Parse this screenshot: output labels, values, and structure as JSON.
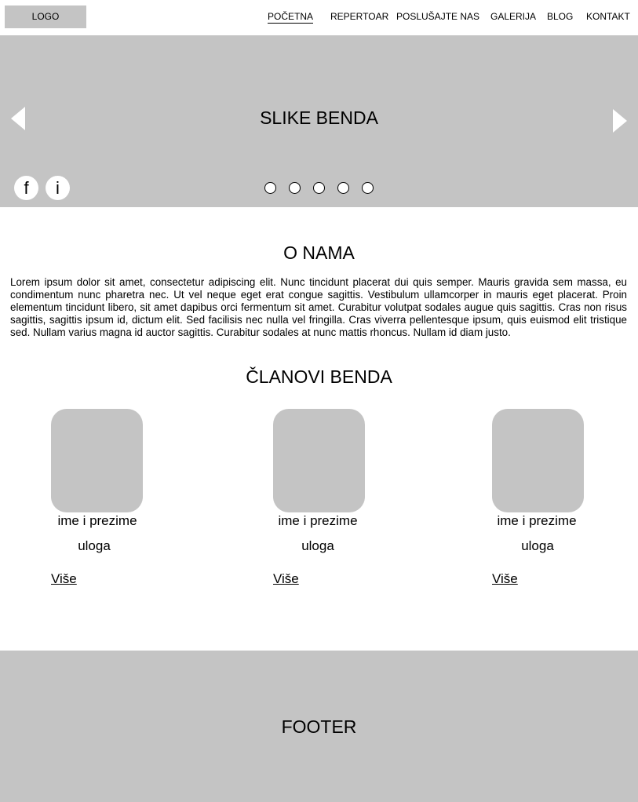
{
  "header": {
    "logo": "LOGO",
    "nav": [
      "POČETNA",
      "REPERTOAR",
      "POSLUŠAJTE NAS",
      "GALERIJA",
      "BLOG",
      "KONTAKT"
    ],
    "active_nav": "POČETNA"
  },
  "hero": {
    "title": "SLIKE BENDA",
    "slide_count": 5,
    "social": {
      "facebook": "f",
      "instagram": "i"
    }
  },
  "about": {
    "title": "O NAMA",
    "text": "Lorem ipsum dolor sit amet, consectetur adipiscing elit. Nunc tincidunt placerat dui quis semper. Mauris gravida sem massa, eu condimentum nunc pharetra nec. Ut vel neque eget erat congue sagittis. Vestibulum ullamcorper in mauris eget placerat. Proin elementum tincidunt libero, sit amet dapibus orci fermentum sit amet. Curabitur volutpat sodales augue quis sagittis. Cras non risus sagittis, sagittis ipsum id, dictum elit. Sed facilisis nec nulla vel fringilla. Cras viverra pellentesque ipsum, quis euismod elit tristique sed. Nullam varius magna id auctor sagittis. Curabitur sodales at nunc mattis rhoncus. Nullam id diam justo."
  },
  "members": {
    "title": "ČLANOVI BENDA",
    "items": [
      {
        "name": "ime i prezime",
        "role": "uloga",
        "more": "Više"
      },
      {
        "name": "ime i prezime",
        "role": "uloga",
        "more": "Više"
      },
      {
        "name": "ime i prezime",
        "role": "uloga",
        "more": "Više"
      }
    ]
  },
  "footer": {
    "title": "FOOTER"
  },
  "colors": {
    "placeholder": "#c4c4c4",
    "background": "#ffffff",
    "text": "#000000"
  }
}
